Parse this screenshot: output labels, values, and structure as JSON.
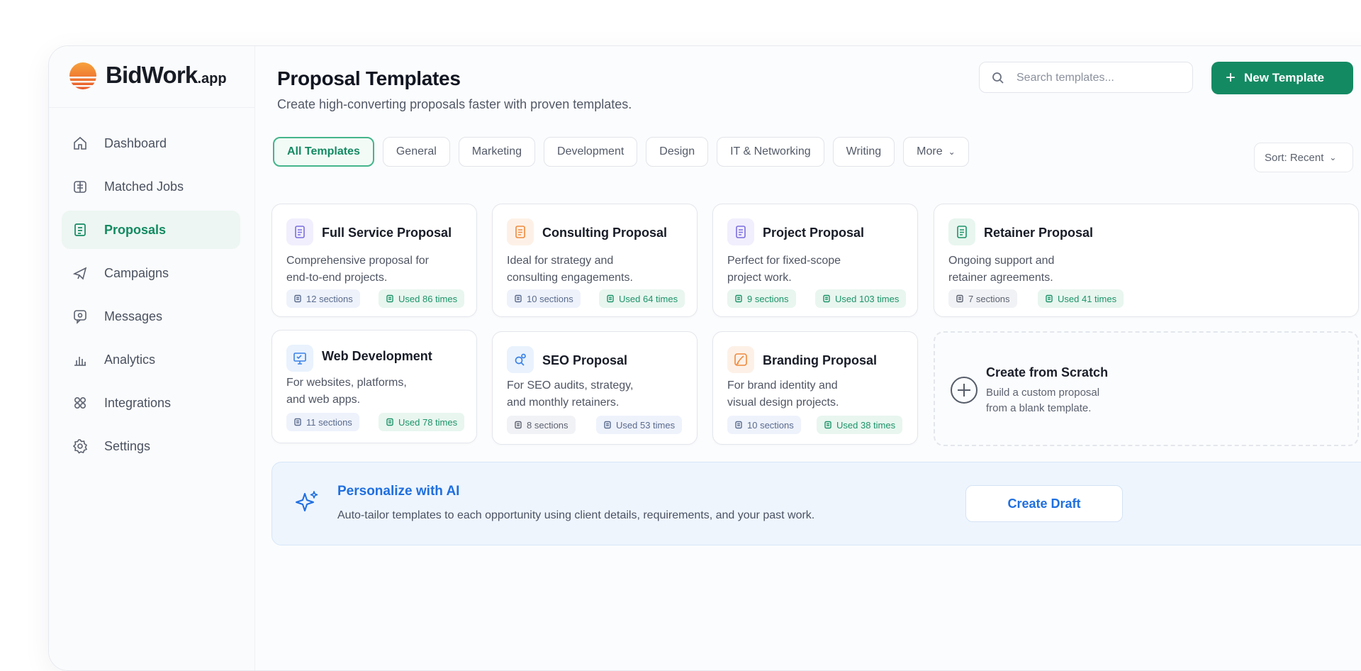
{
  "brand": {
    "name": "BidWork",
    "suffix": ".app"
  },
  "sidebar": {
    "items": [
      {
        "label": "Dashboard",
        "icon": "home-icon"
      },
      {
        "label": "Matched Jobs",
        "icon": "briefcase-icon"
      },
      {
        "label": "Proposals",
        "icon": "document-icon",
        "active": true
      },
      {
        "label": "Campaigns",
        "icon": "megaphone-icon"
      },
      {
        "label": "Messages",
        "icon": "chat-icon"
      },
      {
        "label": "Analytics",
        "icon": "bar-chart-icon"
      },
      {
        "label": "Integrations",
        "icon": "grid-icon"
      },
      {
        "label": "Settings",
        "icon": "gear-icon"
      }
    ]
  },
  "header": {
    "title": "Proposal Templates",
    "subtitle": "Create high-converting proposals faster with proven templates.",
    "search_placeholder": "Search templates...",
    "new_template_label": "New Template"
  },
  "filters": {
    "chips": [
      "All Templates",
      "General",
      "Marketing",
      "Development",
      "Design",
      "IT & Networking",
      "Writing"
    ],
    "more_label": "More",
    "sort_label": "Sort: Recent"
  },
  "templates": [
    {
      "title": "Full Service Proposal",
      "desc_line1": "Comprehensive proposal for",
      "desc_line2": "end-to-end projects.",
      "sections": "12 sections",
      "used": "Used 86 times",
      "icon": "document-icon",
      "color": "#7b6fe0",
      "tint": "#f1effd"
    },
    {
      "title": "Consulting Proposal",
      "desc_line1": "Ideal for strategy and",
      "desc_line2": "consulting engagements.",
      "sections": "10 sections",
      "used": "Used 64 times",
      "icon": "document-icon",
      "color": "#ef8a3d",
      "tint": "#fdf1e7"
    },
    {
      "title": "Project Proposal",
      "desc_line1": "Perfect for fixed-scope",
      "desc_line2": "project work.",
      "sections": "9 sections",
      "used": "Used 103 times",
      "icon": "document-icon",
      "color": "#7b6fe0",
      "tint": "#f1effd"
    },
    {
      "title": "Retainer Proposal",
      "desc_line1": "Ongoing support and",
      "desc_line2": "retainer agreements.",
      "sections": "7 sections",
      "used": "Used 41 times",
      "icon": "document-icon",
      "color": "#1d9369",
      "tint": "#e8f6ef"
    },
    {
      "title": "Web Development",
      "desc_line1": "For websites, platforms,",
      "desc_line2": "and web apps.",
      "sections": "11 sections",
      "used": "Used 78 times",
      "icon": "monitor-icon",
      "color": "#3b82e6",
      "tint": "#e9f2fd"
    },
    {
      "title": "SEO Proposal",
      "desc_line1": "For SEO audits, strategy,",
      "desc_line2": "and monthly retainers.",
      "sections": "8 sections",
      "used": "Used 53 times",
      "icon": "search-icon",
      "color": "#3b82e6",
      "tint": "#e9f2fd"
    },
    {
      "title": "Branding Proposal",
      "desc_line1": "For brand identity and",
      "desc_line2": "visual design projects.",
      "sections": "10 sections",
      "used": "Used 38 times",
      "icon": "brush-icon",
      "color": "#ef8a3d",
      "tint": "#fdf1e7"
    }
  ],
  "scratch": {
    "title": "Create from Scratch",
    "desc_line1": "Build a custom proposal",
    "desc_line2": "from a blank template."
  },
  "ai_banner": {
    "title": "Personalize with AI",
    "desc": "Auto-tailor templates to each opportunity using client details, requirements, and your past work.",
    "button_label": "Create Draft"
  },
  "colors": {
    "accent": "#148a63",
    "ai_blue": "#1f6fe0"
  }
}
